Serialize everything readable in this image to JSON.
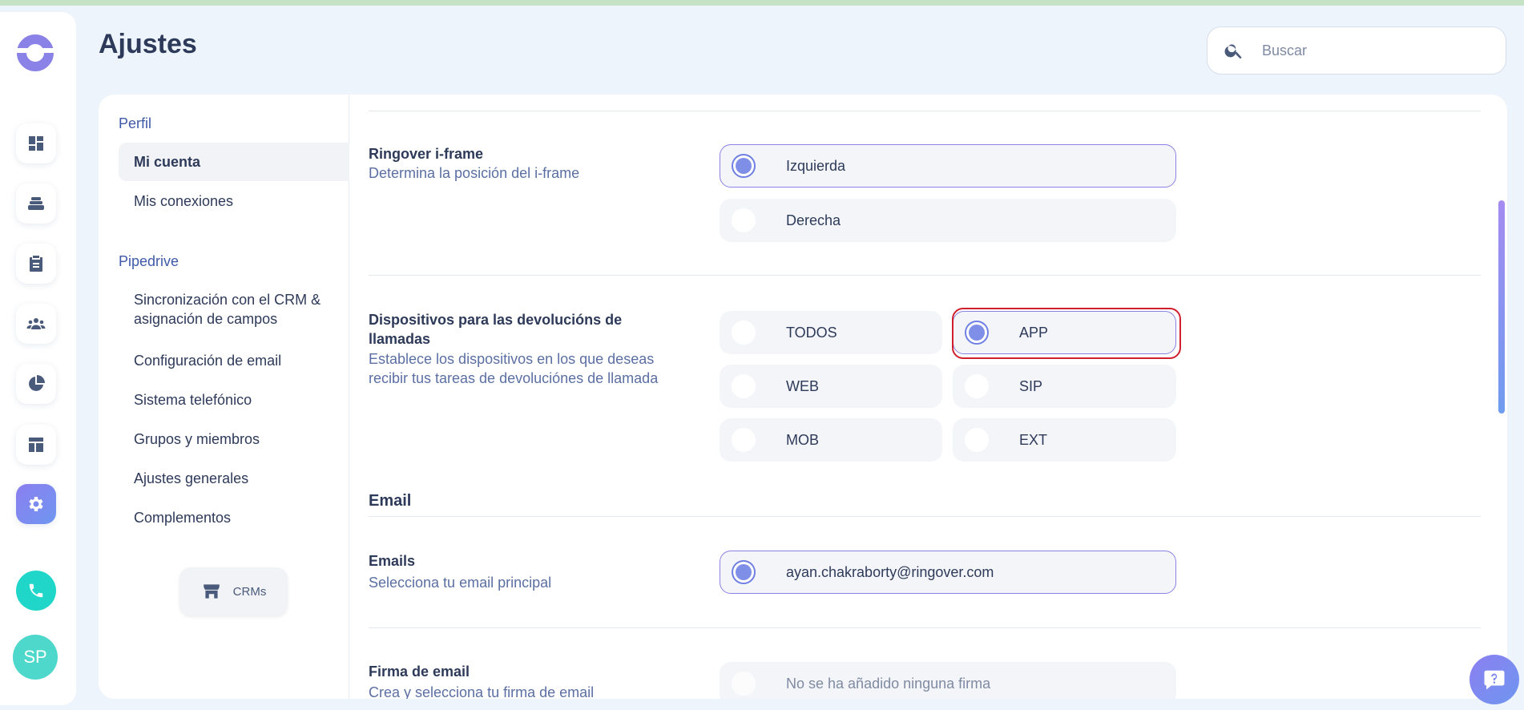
{
  "page": {
    "title": "Ajustes"
  },
  "search": {
    "placeholder": "Buscar"
  },
  "rail": {
    "items": [
      {
        "name": "dashboard-icon"
      },
      {
        "name": "stack-icon"
      },
      {
        "name": "clipboard-icon"
      },
      {
        "name": "team-icon"
      },
      {
        "name": "pie-chart-icon"
      },
      {
        "name": "layout-icon"
      },
      {
        "name": "gear-icon",
        "active": true
      }
    ],
    "avatar_initials": "SP"
  },
  "subnav": {
    "groups": [
      {
        "label": "Perfil",
        "items": [
          "Mi cuenta",
          "Mis conexiones"
        ]
      },
      {
        "label": "Pipedrive",
        "items": [
          "Sincronización con el CRM & asignación de campos",
          "Configuración de email",
          "Sistema telefónico",
          "Grupos y miembros",
          "Ajustes generales",
          "Complementos"
        ]
      }
    ],
    "selected": "Mi cuenta",
    "crms_label": "CRMs"
  },
  "settings": {
    "iframe": {
      "title": "Ringover i-frame",
      "desc": "Determina la posición del i-frame",
      "options": [
        "Izquierda",
        "Derecha"
      ],
      "selected": "Izquierda"
    },
    "devices": {
      "title_line1": "Dispositivos para las devolucións de",
      "title_line2": "llamadas",
      "desc_line1": "Establece los dispositivos en los que deseas",
      "desc_line2": "recibir tus tareas de devoluciónes de llamada",
      "options": [
        "TODOS",
        "APP",
        "WEB",
        "SIP",
        "MOB",
        "EXT"
      ],
      "selected": "APP"
    },
    "email_section": "Email",
    "emails": {
      "title": "Emails",
      "desc": "Selecciona tu email principal",
      "options": [
        "ayan.chakraborty@ringover.com"
      ],
      "selected": "ayan.chakraborty@ringover.com"
    },
    "signature": {
      "title": "Firma de email",
      "desc": "Crea y selecciona tu firma de email",
      "empty": "No se ha añadido ninguna firma"
    }
  },
  "colors": {
    "accent": "#8a82e6",
    "highlight": "#d0202e",
    "teal": "#1fd6c8"
  }
}
